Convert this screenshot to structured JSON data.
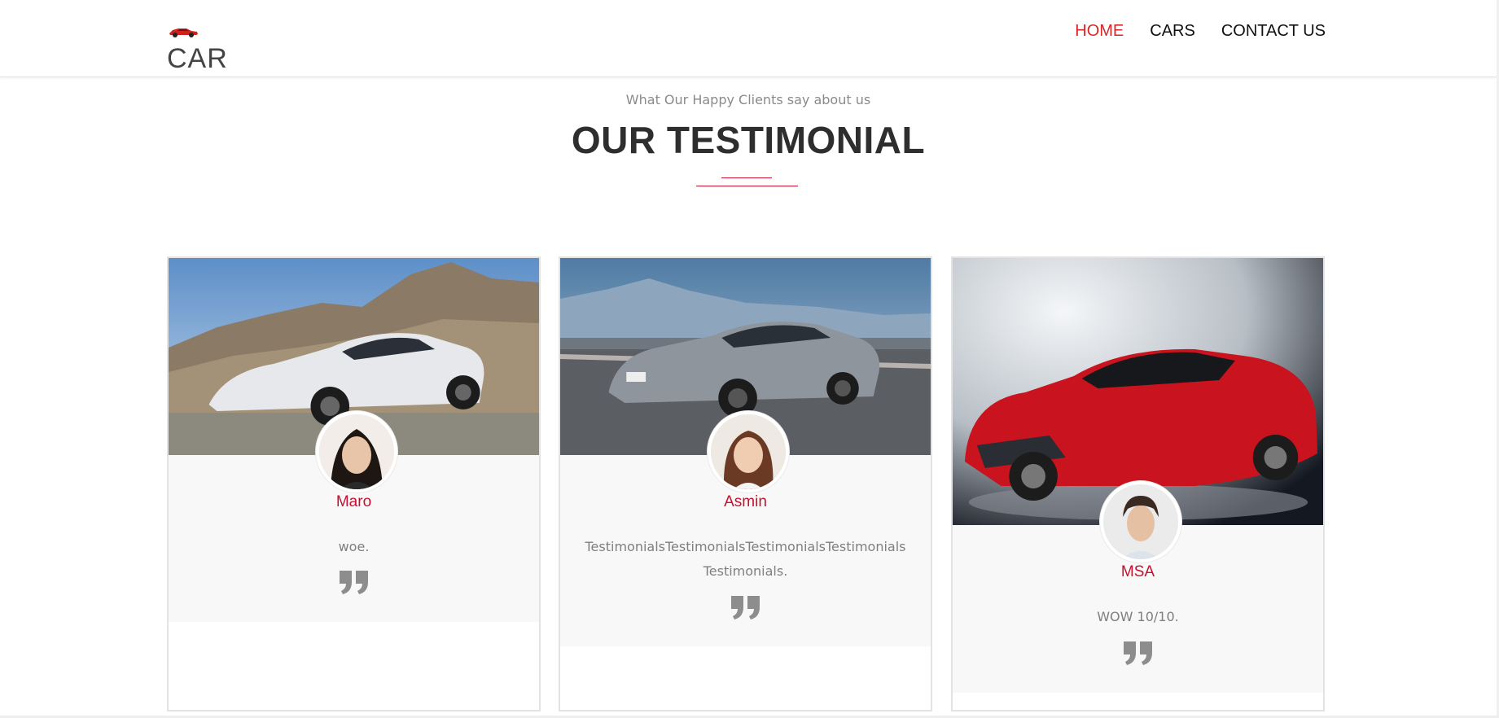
{
  "brand": {
    "name": "CAR",
    "logo_icon": "red-car-icon"
  },
  "nav": {
    "items": [
      "HOME",
      "CARS",
      "CONTACT US"
    ],
    "active": "HOME"
  },
  "section": {
    "subtitle": "What Our Happy Clients say about us",
    "title": "OUR TESTIMONIAL"
  },
  "testimonials": [
    {
      "name": "Maro",
      "text": "woe.",
      "car_color": "white",
      "quote_icon": "quote-icon"
    },
    {
      "name": "Asmin",
      "text": "TestimonialsTestimonialsTestimonialsTestimonials Testimonials.",
      "car_color": "silver",
      "quote_icon": "quote-icon"
    },
    {
      "name": "MSA",
      "text": "WOW 10/10.",
      "car_color": "red",
      "quote_icon": "quote-icon"
    }
  ],
  "colors": {
    "accent": "#c8102e",
    "nav_active": "#d72828",
    "card_body_bg": "#f8f8f8",
    "text_muted": "#8a8a8a"
  }
}
